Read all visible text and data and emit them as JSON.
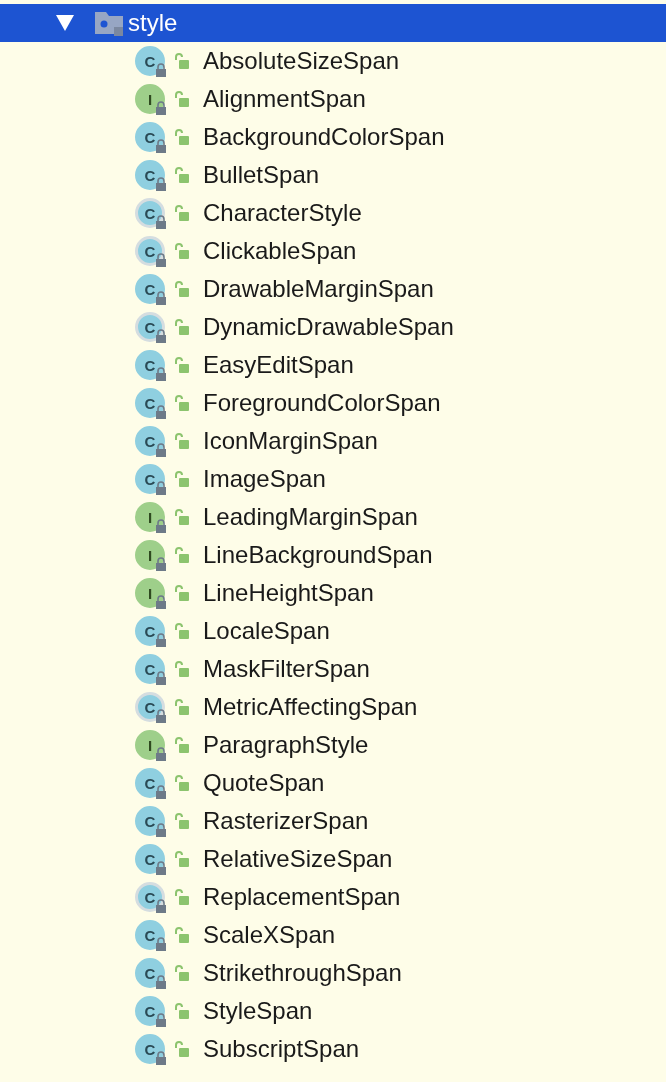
{
  "tree": {
    "folder": {
      "label": "style",
      "expanded": true,
      "selected": true,
      "children": [
        {
          "label": "AbsoluteSizeSpan",
          "kind": "class",
          "badge": "C"
        },
        {
          "label": "AlignmentSpan",
          "kind": "interface",
          "badge": "I"
        },
        {
          "label": "BackgroundColorSpan",
          "kind": "class",
          "badge": "C"
        },
        {
          "label": "BulletSpan",
          "kind": "class",
          "badge": "C"
        },
        {
          "label": "CharacterStyle",
          "kind": "abstract",
          "badge": "C"
        },
        {
          "label": "ClickableSpan",
          "kind": "abstract",
          "badge": "C"
        },
        {
          "label": "DrawableMarginSpan",
          "kind": "class",
          "badge": "C"
        },
        {
          "label": "DynamicDrawableSpan",
          "kind": "abstract",
          "badge": "C"
        },
        {
          "label": "EasyEditSpan",
          "kind": "class",
          "badge": "C"
        },
        {
          "label": "ForegroundColorSpan",
          "kind": "class",
          "badge": "C"
        },
        {
          "label": "IconMarginSpan",
          "kind": "class",
          "badge": "C"
        },
        {
          "label": "ImageSpan",
          "kind": "class",
          "badge": "C"
        },
        {
          "label": "LeadingMarginSpan",
          "kind": "interface",
          "badge": "I"
        },
        {
          "label": "LineBackgroundSpan",
          "kind": "interface",
          "badge": "I"
        },
        {
          "label": "LineHeightSpan",
          "kind": "interface",
          "badge": "I"
        },
        {
          "label": "LocaleSpan",
          "kind": "class",
          "badge": "C"
        },
        {
          "label": "MaskFilterSpan",
          "kind": "class",
          "badge": "C"
        },
        {
          "label": "MetricAffectingSpan",
          "kind": "abstract",
          "badge": "C"
        },
        {
          "label": "ParagraphStyle",
          "kind": "interface",
          "badge": "I"
        },
        {
          "label": "QuoteSpan",
          "kind": "class",
          "badge": "C"
        },
        {
          "label": "RasterizerSpan",
          "kind": "class",
          "badge": "C"
        },
        {
          "label": "RelativeSizeSpan",
          "kind": "class",
          "badge": "C"
        },
        {
          "label": "ReplacementSpan",
          "kind": "abstract",
          "badge": "C"
        },
        {
          "label": "ScaleXSpan",
          "kind": "class",
          "badge": "C"
        },
        {
          "label": "StrikethroughSpan",
          "kind": "class",
          "badge": "C"
        },
        {
          "label": "StyleSpan",
          "kind": "class",
          "badge": "C"
        },
        {
          "label": "SubscriptSpan",
          "kind": "class",
          "badge": "C"
        }
      ]
    }
  }
}
